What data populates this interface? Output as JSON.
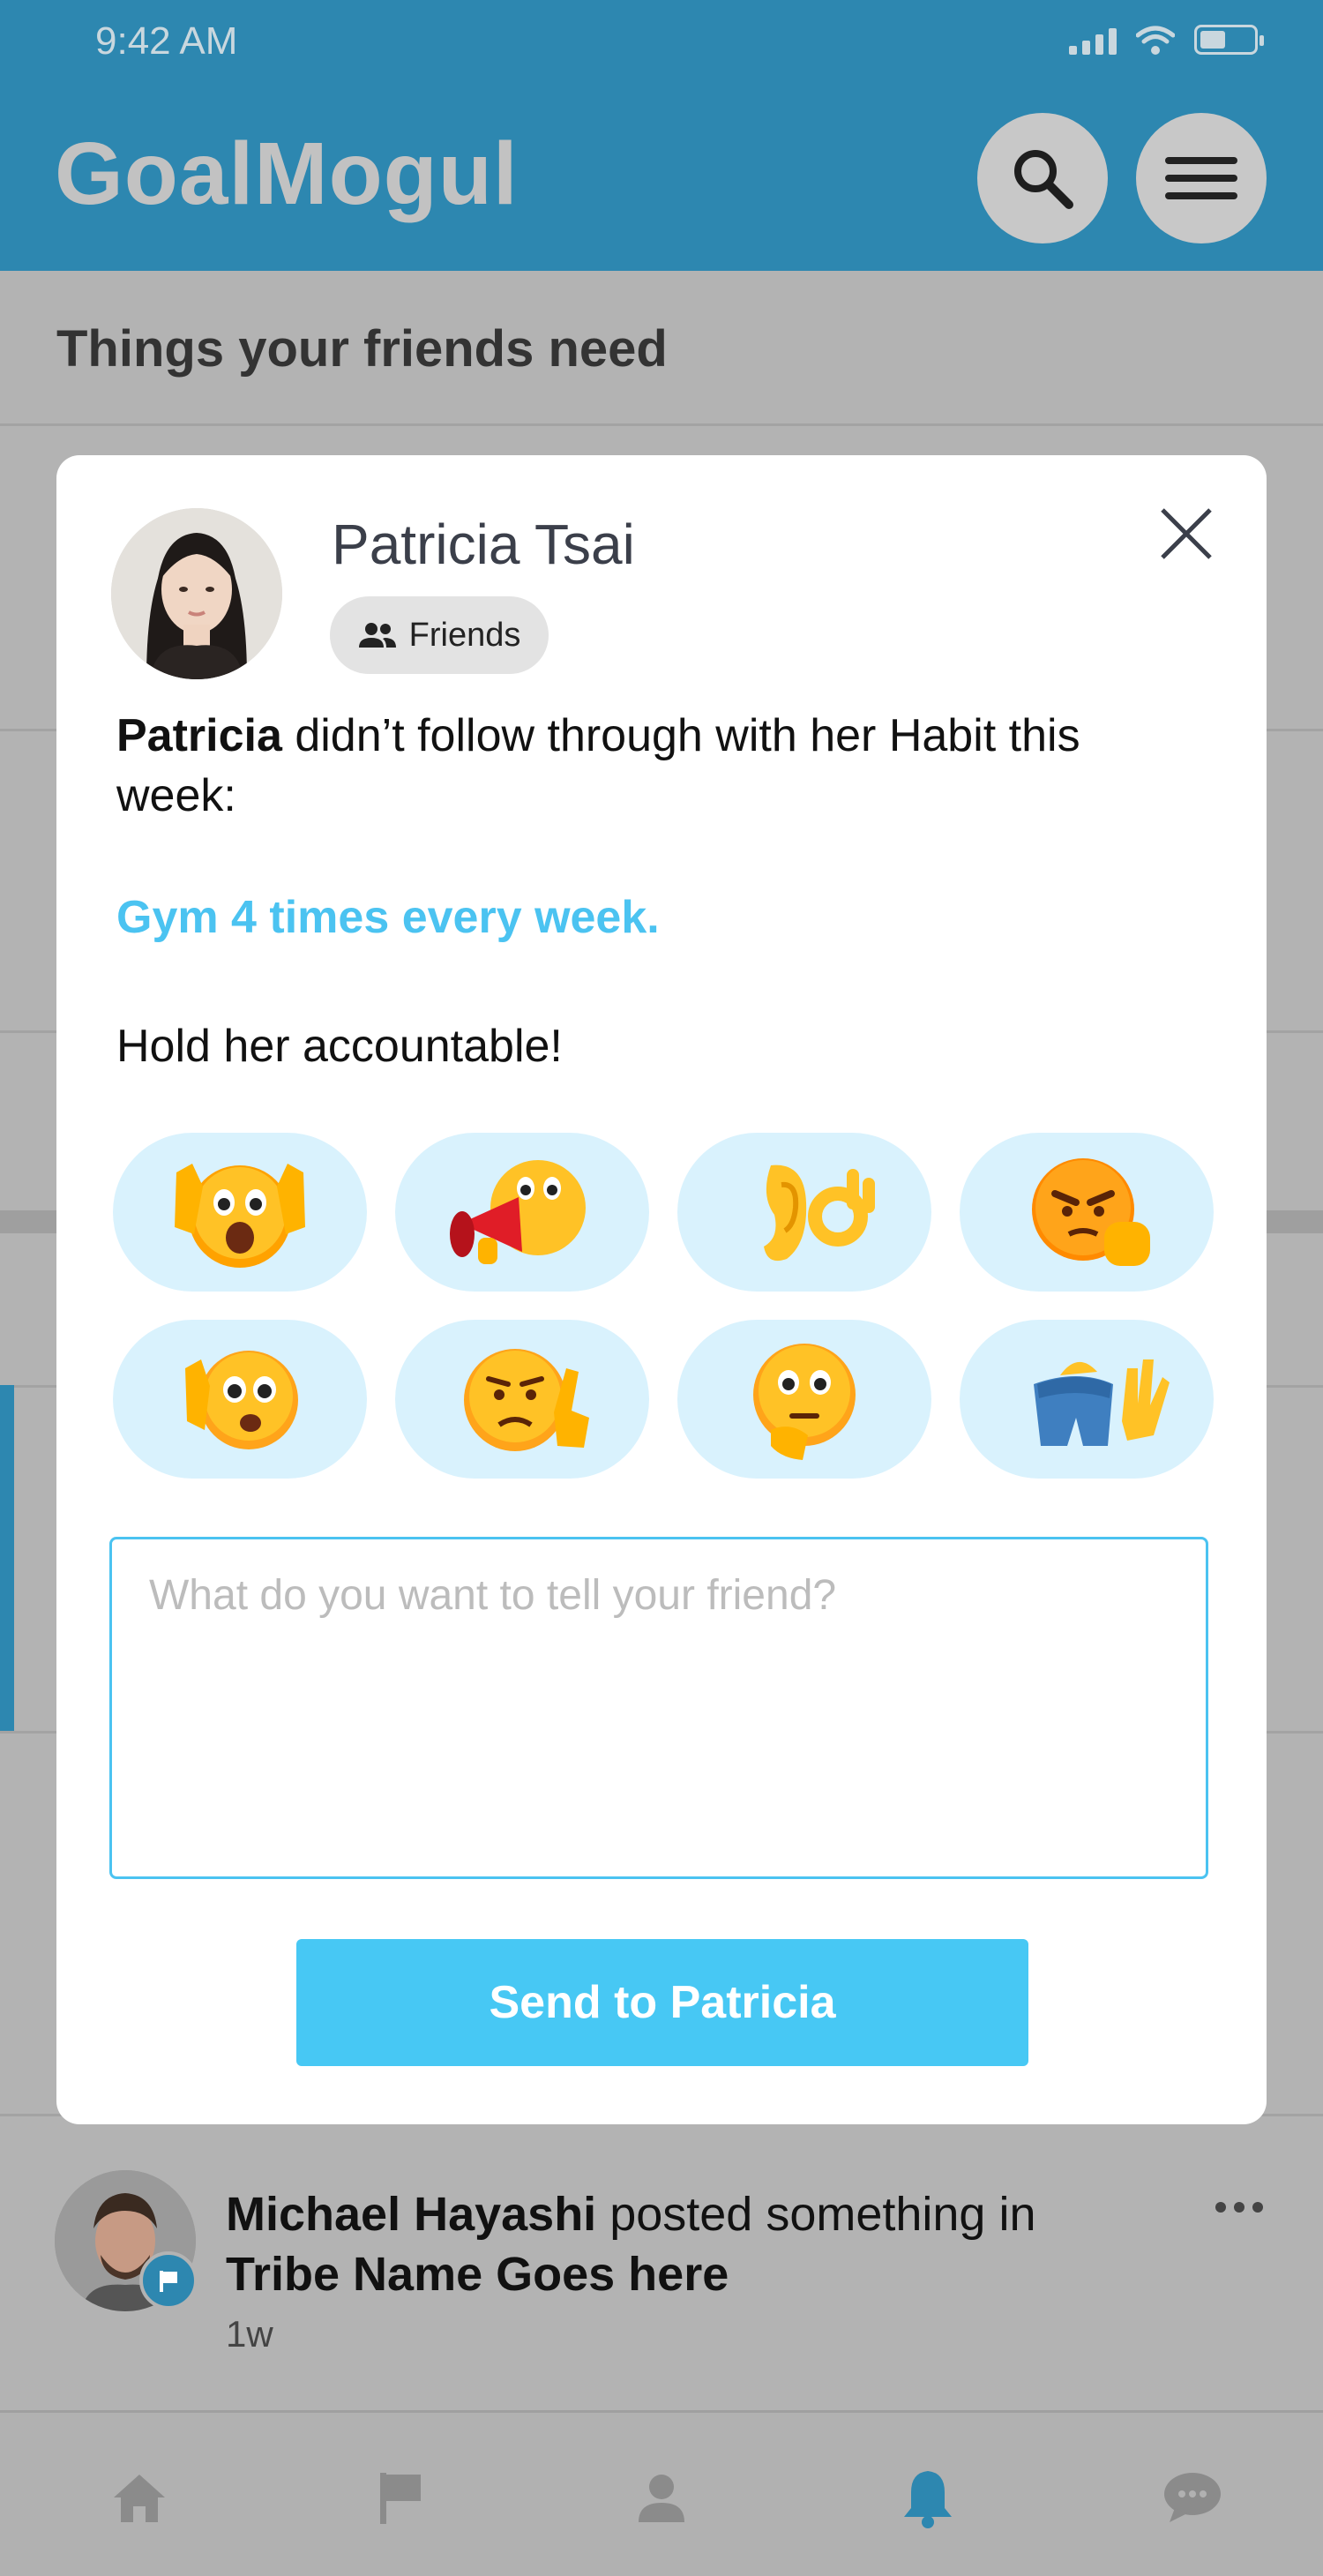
{
  "status_bar": {
    "time": "9:42 AM"
  },
  "header": {
    "brand": "GoalMogul",
    "search_icon": "search-icon",
    "menu_icon": "menu-icon"
  },
  "feed": {
    "section_title": "Things your friends need"
  },
  "modal": {
    "name": "Patricia Tsai",
    "relationship_chip": "Friends",
    "message_first_name": "Patricia",
    "message_rest": " didn’t follow through with her Habit this week:",
    "habit": "Gym 4 times every week.",
    "prompt": "Hold her accountable!",
    "reactions": [
      "scream-hands-emoji",
      "megaphone-emoji",
      "ear-ok-emoji",
      "angry-fist-emoji",
      "shocked-hand-emoji",
      "frown-pointing-emoji",
      "thinking-emoji",
      "butt-wave-emoji"
    ],
    "message_placeholder": "What do you want to tell your friend?",
    "send_label": "Send to Patricia",
    "accent_color": "#4bc3f1"
  },
  "post": {
    "author": "Michael Hayashi",
    "action": " posted something in ",
    "tribe": "Tribe Name Goes here",
    "time": "1w"
  },
  "bottom_nav": [
    "home-icon",
    "flag-icon",
    "profile-icon",
    "bell-icon",
    "chat-icon"
  ]
}
